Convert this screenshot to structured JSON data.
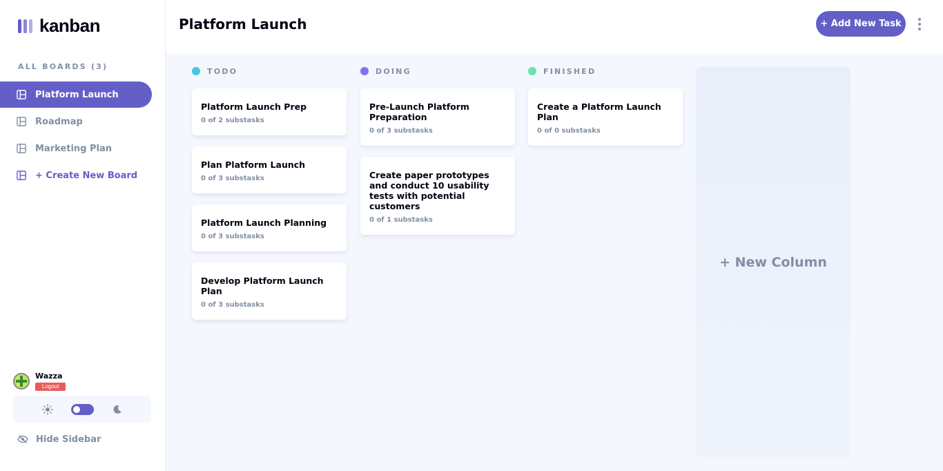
{
  "app": {
    "logo_text": "kanban"
  },
  "sidebar": {
    "boards_heading": "ALL BOARDS (3)",
    "boards": [
      {
        "label": "Platform Launch",
        "active": true
      },
      {
        "label": "Roadmap",
        "active": false
      },
      {
        "label": "Marketing Plan",
        "active": false
      }
    ],
    "create_board_label": "+ Create New Board",
    "user": {
      "name": "Wazza",
      "logout_label": "Logout"
    },
    "theme": {
      "mode": "light",
      "toggle_icons": [
        "sun-icon",
        "moon-icon"
      ]
    },
    "hide_sidebar_label": "Hide Sidebar"
  },
  "header": {
    "title": "Platform Launch",
    "add_task_label": "+ Add New Task",
    "menu_icon": "kebab-icon"
  },
  "columns": [
    {
      "name": "TODO",
      "color": "#49c4e5",
      "tasks": [
        {
          "title": "Platform Launch Prep",
          "subtasks": "0 of 2 substasks"
        },
        {
          "title": "Plan Platform Launch",
          "subtasks": "0 of 3 substasks"
        },
        {
          "title": "Platform Launch Planning",
          "subtasks": "0 of 3 substasks"
        },
        {
          "title": "Develop Platform Launch Plan",
          "subtasks": "0 of 3 substasks"
        }
      ]
    },
    {
      "name": "DOING",
      "color": "#8471f2",
      "tasks": [
        {
          "title": "Pre-Launch Platform Preparation",
          "subtasks": "0 of 3 substasks"
        },
        {
          "title": "Create paper prototypes and conduct 10 usability tests with potential customers",
          "subtasks": "0 of 1 substasks"
        }
      ]
    },
    {
      "name": "FINISHED",
      "color": "#67e2ae",
      "tasks": [
        {
          "title": "Create a Platform Launch Plan",
          "subtasks": "0 of 0 substasks"
        }
      ]
    }
  ],
  "new_column_label": "+ New Column",
  "colors": {
    "accent": "#635fc7",
    "background": "#f4f7fd",
    "muted_text": "#828fa3",
    "logout": "#e85c5c"
  }
}
